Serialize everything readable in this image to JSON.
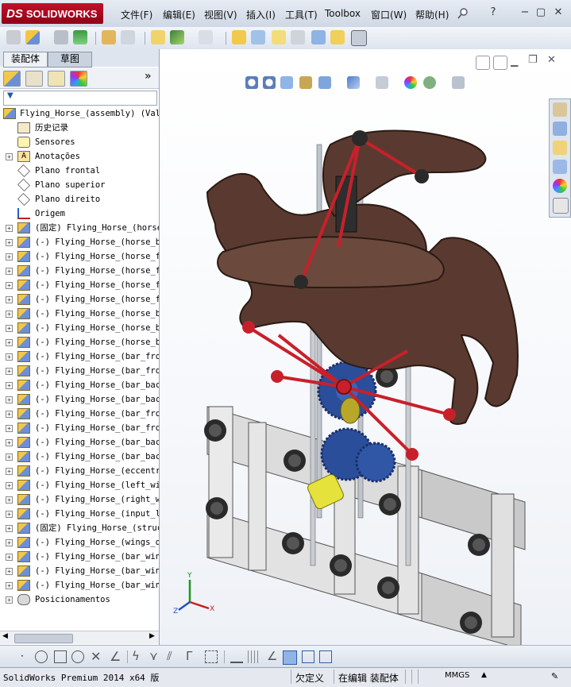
{
  "app": {
    "brand": "SOLIDWORKS",
    "brand_mark": "DS"
  },
  "menu": [
    "文件(F)",
    "编辑(E)",
    "视图(V)",
    "插入(I)",
    "工具(T)",
    "Toolbox",
    "窗口(W)",
    "帮助(H)"
  ],
  "window_controls": {
    "help": "?",
    "minimize": "−",
    "restore": "▢",
    "close": "✕"
  },
  "left_panel": {
    "tabs": [
      "装配体",
      "草图"
    ],
    "expand_glyph": "»",
    "filter_glyph": "▼",
    "tree": [
      {
        "label": "Flying_Horse_(assembly)  (Val",
        "icon": "assembly-icon",
        "top": true
      },
      {
        "label": "历史记录",
        "icon": "history-icon"
      },
      {
        "label": "Sensores",
        "icon": "sensor-icon"
      },
      {
        "label": "Anotações",
        "icon": "annotation-icon",
        "expandable": true
      },
      {
        "label": "Plano frontal",
        "icon": "plane-icon"
      },
      {
        "label": "Plano superior",
        "icon": "plane-icon"
      },
      {
        "label": "Plano direito",
        "icon": "plane-icon"
      },
      {
        "label": "Origem",
        "icon": "origin-icon"
      },
      {
        "label": "(固定) Flying_Horse_(horse",
        "icon": "part-icon",
        "expandable": true
      },
      {
        "label": "(-) Flying_Horse_(horse_ba",
        "icon": "part-icon",
        "expandable": true
      },
      {
        "label": "(-) Flying_Horse_(horse_fr",
        "icon": "part-icon",
        "expandable": true
      },
      {
        "label": "(-) Flying_Horse_(horse_fr",
        "icon": "part-icon",
        "expandable": true
      },
      {
        "label": "(-) Flying_Horse_(horse_fr",
        "icon": "part-icon",
        "expandable": true
      },
      {
        "label": "(-) Flying_Horse_(horse_fr",
        "icon": "part-icon",
        "expandable": true
      },
      {
        "label": "(-) Flying_Horse_(horse_ba",
        "icon": "part-icon",
        "expandable": true
      },
      {
        "label": "(-) Flying_Horse_(horse_ba",
        "icon": "part-icon",
        "expandable": true
      },
      {
        "label": "(-) Flying_Horse_(horse_ba",
        "icon": "part-icon",
        "expandable": true
      },
      {
        "label": "(-) Flying_Horse_(bar_fron",
        "icon": "part-icon",
        "expandable": true
      },
      {
        "label": "(-) Flying_Horse_(bar_fron",
        "icon": "part-icon",
        "expandable": true
      },
      {
        "label": "(-) Flying_Horse_(bar_back",
        "icon": "part-icon",
        "expandable": true
      },
      {
        "label": "(-) Flying_Horse_(bar_back",
        "icon": "part-icon",
        "expandable": true
      },
      {
        "label": "(-) Flying_Horse_(bar_fron",
        "icon": "part-icon",
        "expandable": true
      },
      {
        "label": "(-) Flying_Horse_(bar_fron",
        "icon": "part-icon",
        "expandable": true
      },
      {
        "label": "(-) Flying_Horse_(bar_back",
        "icon": "part-icon",
        "expandable": true
      },
      {
        "label": "(-) Flying_Horse_(bar_back",
        "icon": "part-icon",
        "expandable": true
      },
      {
        "label": "(-) Flying_Horse_(eccentri",
        "icon": "part-icon",
        "expandable": true
      },
      {
        "label": "(-) Flying_Horse_(left_win",
        "icon": "part-icon",
        "expandable": true
      },
      {
        "label": "(-) Flying_Horse_(right_wi",
        "icon": "part-icon",
        "expandable": true
      },
      {
        "label": "(-) Flying_Horse_(input_le",
        "icon": "part-icon",
        "expandable": true
      },
      {
        "label": "(固定) Flying_Horse_(struc",
        "icon": "part-icon",
        "expandable": true
      },
      {
        "label": "(-) Flying_Horse_(wings_dr",
        "icon": "part-icon",
        "expandable": true
      },
      {
        "label": "(-) Flying_Horse_(bar_wing",
        "icon": "part-icon",
        "expandable": true
      },
      {
        "label": "(-) Flying_Horse_(bar_wing",
        "icon": "part-icon",
        "expandable": true
      },
      {
        "label": "(-) Flying_Horse_(bar_wing",
        "icon": "part-icon",
        "expandable": true
      },
      {
        "label": "Posicionamentos",
        "icon": "mates-icon",
        "expandable": true
      }
    ]
  },
  "viewport": {
    "triad": {
      "x": "X",
      "y": "Y",
      "z": "Z"
    }
  },
  "status": {
    "product": "SolidWorks Premium 2014 x64 版",
    "state": "欠定义",
    "mode": "在编辑 装配体",
    "units": "MMGS"
  },
  "colors": {
    "horse": "#5a3a30",
    "rods": "#c8202a",
    "gears": "#2a4e9a",
    "frame": "#e8e8e8",
    "brand": "#b0102a"
  }
}
